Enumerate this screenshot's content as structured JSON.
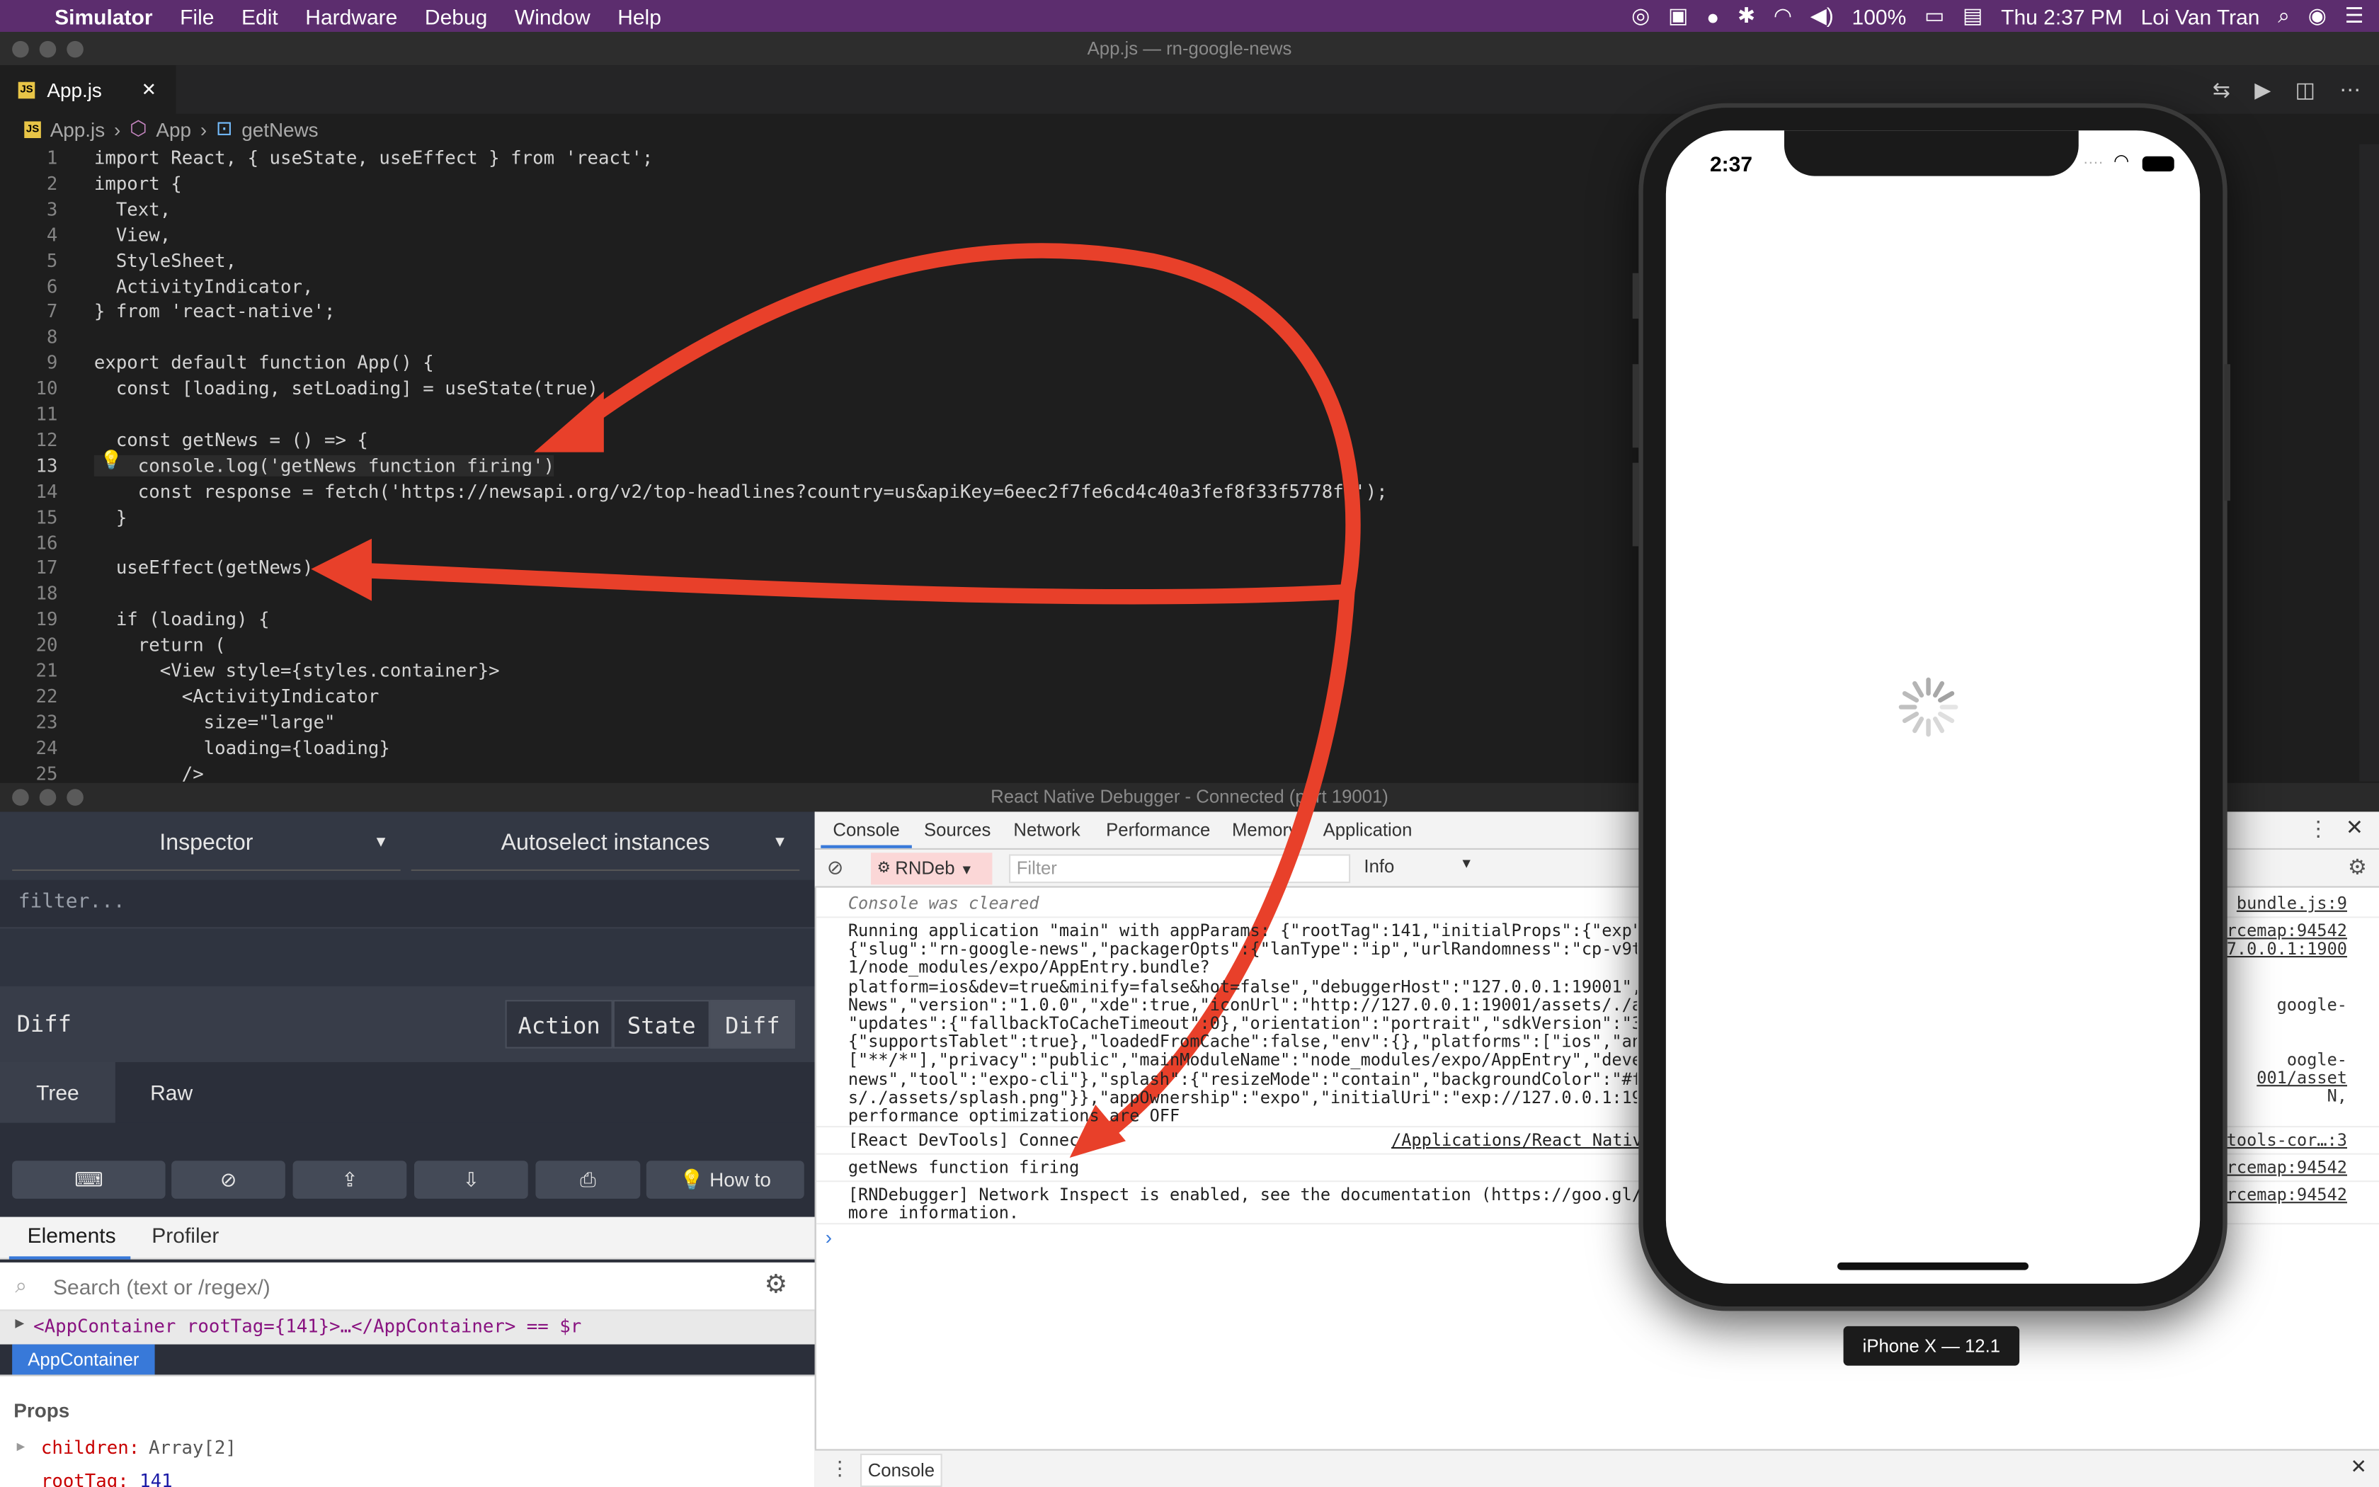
{
  "menubar": {
    "app": "Simulator",
    "items": [
      "File",
      "Edit",
      "Hardware",
      "Debug",
      "Window",
      "Help"
    ],
    "battery": "100%",
    "clock": "Thu 2:37 PM",
    "user": "Loi Van Tran"
  },
  "editor": {
    "window_title": "App.js — rn-google-news",
    "tab_label": "App.js",
    "breadcrumb": [
      "App.js",
      "App",
      "getNews"
    ]
  },
  "code_lines": [
    {
      "n": "1",
      "t": "import React, { useState, useEffect } from 'react';"
    },
    {
      "n": "2",
      "t": "import {"
    },
    {
      "n": "3",
      "t": "  Text,"
    },
    {
      "n": "4",
      "t": "  View,"
    },
    {
      "n": "5",
      "t": "  StyleSheet,"
    },
    {
      "n": "6",
      "t": "  ActivityIndicator,"
    },
    {
      "n": "7",
      "t": "} from 'react-native';"
    },
    {
      "n": "8",
      "t": ""
    },
    {
      "n": "9",
      "t": "export default function App() {"
    },
    {
      "n": "10",
      "t": "  const [loading, setLoading] = useState(true)"
    },
    {
      "n": "11",
      "t": ""
    },
    {
      "n": "12",
      "t": "  const getNews = () => {"
    },
    {
      "n": "13",
      "t": "    console.log('getNews function firing')"
    },
    {
      "n": "14",
      "t": "    const response = fetch('https://newsapi.org/v2/top-headlines?country=us&apiKey=6eec2f7fe6cd4c40a3fef8f33f5778fe');"
    },
    {
      "n": "15",
      "t": "  }"
    },
    {
      "n": "16",
      "t": ""
    },
    {
      "n": "17",
      "t": "  useEffect(getNews)"
    },
    {
      "n": "18",
      "t": ""
    },
    {
      "n": "19",
      "t": "  if (loading) {"
    },
    {
      "n": "20",
      "t": "    return ("
    },
    {
      "n": "21",
      "t": "      <View style={styles.container}>"
    },
    {
      "n": "22",
      "t": "        <ActivityIndicator"
    },
    {
      "n": "23",
      "t": "          size=\"large\""
    },
    {
      "n": "24",
      "t": "          loading={loading}"
    },
    {
      "n": "25",
      "t": "        />"
    }
  ],
  "debugger": {
    "title": "React Native Debugger - Connected (port 19001)",
    "inspector_label": "Inspector",
    "autoselect_label": "Autoselect instances",
    "filter_placeholder": "filter...",
    "diff_label": "Diff",
    "seg_action": "Action",
    "seg_state": "State",
    "seg_diff": "Diff",
    "tab_tree": "Tree",
    "tab_raw": "Raw",
    "howto": "How to",
    "elements_tab": "Elements",
    "profiler_tab": "Profiler",
    "search_placeholder": "Search (text or /regex/)",
    "tree_row": "<AppContainer rootTag={141}>…</AppContainer> == $r",
    "selected_node": "AppContainer",
    "props_heading": "Props",
    "prop1_key": "children:",
    "prop1_val": "Array[2]",
    "prop2_key": "rootTag:",
    "prop2_val": "141"
  },
  "console": {
    "tabs": [
      "Console",
      "Sources",
      "Network",
      "Performance",
      "Memory",
      "Application"
    ],
    "context": "RNDeb",
    "filter_placeholder": "Filter",
    "level": "Info",
    "cleared": "Console was cleared",
    "cleared_src": "bundle.js:9",
    "running_lines": [
      "Running application \"main\" with appParams: {\"rootTag\":141,\"initialProps\":{\"exp\":{\"manifest\":",
      "{\"slug\":\"rn-google-news\",\"packagerOpts\":{\"lanType\":\"ip\",\"urlRandomness\":\"cp-v9t\",\"hostType\":",
      "1/node_modules/expo/AppEntry.bundle?",
      "platform=ios&dev=true&minify=false&hot=false\",\"debuggerHost\":\"127.0.0.1:19001\",\"iconUrl\":",
      "News\",\"version\":\"1.0.0\",\"xde\":true,\"iconUrl\":\"http://127.0.0.1:19001/assets/./assets",
      "\"updates\":{\"fallbackToCacheTimeout\":0},\"orientation\":\"portrait\",\"sdkVersion\":\"3",
      "{\"supportsTablet\":true},\"loadedFromCache\":false,\"env\":{},\"platforms\":[\"ios\",\"android\"",
      "[\"**/*\"],\"privacy\":\"public\",\"mainModuleName\":\"node_modules/expo/AppEntry\",\"developer\":",
      "news\",\"tool\":\"expo-cli\"},\"splash\":{\"resizeMode\":\"contain\",\"backgroundColor\":\"#ffffff",
      "s/./assets/splash.png\"}},\"appOwnership\":\"expo\",\"initialUri\":\"exp://127.0.0.1:19000\",",
      "performance optimizations are OFF"
    ],
    "running_src": [
      "urcemap:94542",
      "27.0.0.1:1900",
      "google-",
      "oogle-",
      "001/asset",
      "N,"
    ],
    "devtools": "[React DevTools] Connected",
    "devtools_path": "/Applications/React Native",
    "devtools_src": "vtools-cor…:3",
    "log": "getNews function firing",
    "log_src": "urcemap:94542",
    "rndebugger": "[RNDebugger] Network Inspect is enabled, see the documentation (https://goo.gl/yEcRrU",
    "rndebugger2": "more information.",
    "rndebugger_src": "urcemap:94542",
    "bottom_tab": "Console"
  },
  "phone": {
    "time": "2:37",
    "device": "iPhone X — 12.1"
  },
  "colors": {
    "menubar": "#5c2d6e",
    "arrow": "#e8402a",
    "selection": "#3879d9"
  }
}
